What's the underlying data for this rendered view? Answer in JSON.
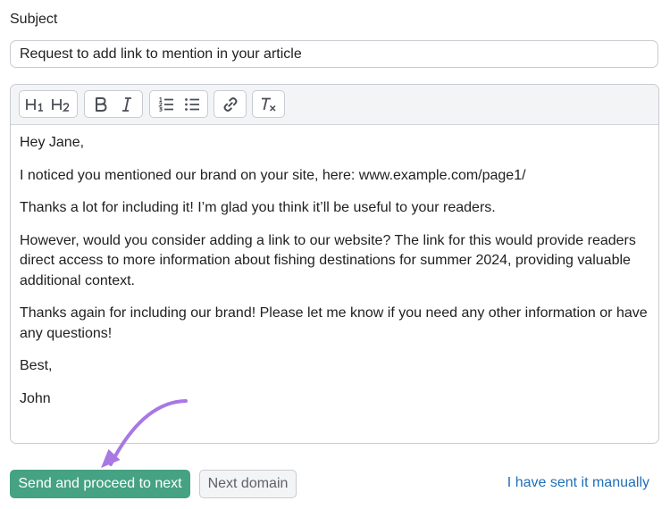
{
  "subject": {
    "label": "Subject",
    "value": "Request to add link to mention in your article"
  },
  "toolbar": {
    "buttons": [
      {
        "icon": "heading-1-icon"
      },
      {
        "icon": "heading-2-icon"
      },
      {
        "icon": "bold-icon"
      },
      {
        "icon": "italic-icon"
      },
      {
        "icon": "ordered-list-icon"
      },
      {
        "icon": "bullet-list-icon"
      },
      {
        "icon": "link-icon"
      },
      {
        "icon": "clear-format-icon"
      }
    ]
  },
  "email_body": {
    "paragraphs": [
      "Hey Jane,",
      "I noticed you mentioned our brand on your site, here: www.example.com/page1/",
      "Thanks a lot for including it! I’m glad you think it’ll be useful to your readers.",
      "However, would you consider adding a link to our website? The link for this would provide readers direct access to more information about fishing destinations for summer 2024, providing valuable additional context.",
      "Thanks again for including our brand! Please let me know if you need any other information or have any questions!",
      "Best,",
      "John"
    ]
  },
  "actions": {
    "send_label": "Send and proceed to next",
    "next_label": "Next domain",
    "manual_label": "I have sent it manually"
  },
  "colors": {
    "primary": "#45a283",
    "link": "#1f6fb8",
    "arrow": "#a878e3"
  }
}
